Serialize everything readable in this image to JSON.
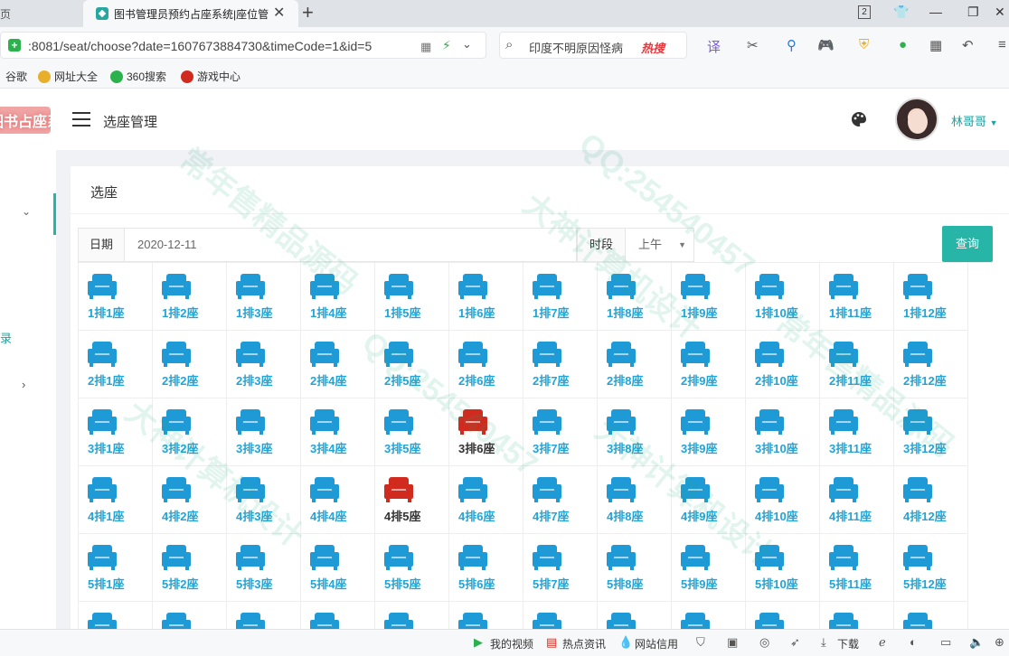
{
  "browser": {
    "prev_tab_label": "页",
    "tab_title": "图书管理员预约占座系统|座位管",
    "tab_count": "2",
    "url": ":8081/seat/choose?date=1607673884730&timeCode=1&id=5",
    "search_query": "印度不明原因怪病",
    "search_hot": "热搜",
    "bookmarks": [
      "谷歌",
      "网址大全",
      "360搜索",
      "游戏中心"
    ]
  },
  "app": {
    "logo_text": "图书占座系统",
    "header_title": "选座管理",
    "username": "林哥哥",
    "sidebar_link": "录",
    "card_title": "选座",
    "filters": {
      "date_label": "日期",
      "date_value": "2020-12-11",
      "period_label": "时段",
      "period_value": "上午",
      "query_button": "查询"
    },
    "colors": {
      "available": "#1e9ad6",
      "taken": "#d12a1e",
      "accent": "#27b5a8"
    },
    "seats": [
      {
        "label": "1排1座",
        "taken": false
      },
      {
        "label": "1排2座",
        "taken": false
      },
      {
        "label": "1排3座",
        "taken": false
      },
      {
        "label": "1排4座",
        "taken": false
      },
      {
        "label": "1排5座",
        "taken": false
      },
      {
        "label": "1排6座",
        "taken": false
      },
      {
        "label": "1排7座",
        "taken": false
      },
      {
        "label": "1排8座",
        "taken": false
      },
      {
        "label": "1排9座",
        "taken": false
      },
      {
        "label": "1排10座",
        "taken": false
      },
      {
        "label": "1排11座",
        "taken": false
      },
      {
        "label": "1排12座",
        "taken": false
      },
      {
        "label": "2排1座",
        "taken": false
      },
      {
        "label": "2排2座",
        "taken": false
      },
      {
        "label": "2排3座",
        "taken": false
      },
      {
        "label": "2排4座",
        "taken": false
      },
      {
        "label": "2排5座",
        "taken": false
      },
      {
        "label": "2排6座",
        "taken": false
      },
      {
        "label": "2排7座",
        "taken": false
      },
      {
        "label": "2排8座",
        "taken": false
      },
      {
        "label": "2排9座",
        "taken": false
      },
      {
        "label": "2排10座",
        "taken": false
      },
      {
        "label": "2排11座",
        "taken": false
      },
      {
        "label": "2排12座",
        "taken": false
      },
      {
        "label": "3排1座",
        "taken": false
      },
      {
        "label": "3排2座",
        "taken": false
      },
      {
        "label": "3排3座",
        "taken": false
      },
      {
        "label": "3排4座",
        "taken": false
      },
      {
        "label": "3排5座",
        "taken": false
      },
      {
        "label": "3排6座",
        "taken": true
      },
      {
        "label": "3排7座",
        "taken": false
      },
      {
        "label": "3排8座",
        "taken": false
      },
      {
        "label": "3排9座",
        "taken": false
      },
      {
        "label": "3排10座",
        "taken": false
      },
      {
        "label": "3排11座",
        "taken": false
      },
      {
        "label": "3排12座",
        "taken": false
      },
      {
        "label": "4排1座",
        "taken": false
      },
      {
        "label": "4排2座",
        "taken": false
      },
      {
        "label": "4排3座",
        "taken": false
      },
      {
        "label": "4排4座",
        "taken": false
      },
      {
        "label": "4排5座",
        "taken": true
      },
      {
        "label": "4排6座",
        "taken": false
      },
      {
        "label": "4排7座",
        "taken": false
      },
      {
        "label": "4排8座",
        "taken": false
      },
      {
        "label": "4排9座",
        "taken": false
      },
      {
        "label": "4排10座",
        "taken": false
      },
      {
        "label": "4排11座",
        "taken": false
      },
      {
        "label": "4排12座",
        "taken": false
      },
      {
        "label": "5排1座",
        "taken": false
      },
      {
        "label": "5排2座",
        "taken": false
      },
      {
        "label": "5排3座",
        "taken": false
      },
      {
        "label": "5排4座",
        "taken": false
      },
      {
        "label": "5排5座",
        "taken": false
      },
      {
        "label": "5排6座",
        "taken": false
      },
      {
        "label": "5排7座",
        "taken": false
      },
      {
        "label": "5排8座",
        "taken": false
      },
      {
        "label": "5排9座",
        "taken": false
      },
      {
        "label": "5排10座",
        "taken": false
      },
      {
        "label": "5排11座",
        "taken": false
      },
      {
        "label": "5排12座",
        "taken": false
      }
    ]
  },
  "statusbar": {
    "items": [
      "我的视频",
      "热点资讯",
      "网站信用",
      "下载"
    ]
  },
  "watermark": {
    "lines": [
      "QQ:254540457",
      "大神计算机设计",
      "常年售精品源码"
    ]
  }
}
